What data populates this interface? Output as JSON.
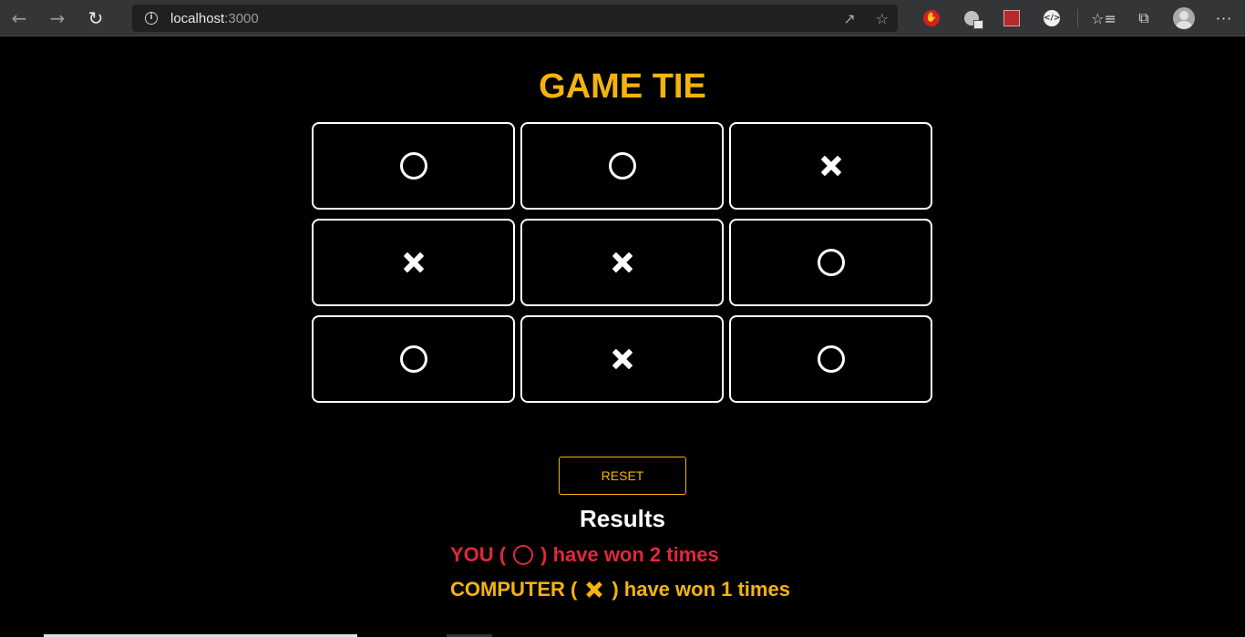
{
  "browser": {
    "url_host": "localhost",
    "url_port": ":3000"
  },
  "game": {
    "status": "GAME TIE",
    "board": [
      "O",
      "O",
      "X",
      "X",
      "X",
      "O",
      "O",
      "X",
      "O"
    ],
    "reset_label": "RESET"
  },
  "results": {
    "heading": "Results",
    "you": {
      "prefix": "YOU (",
      "suffix": ") have won 2 times",
      "wins": 2,
      "mark": "O"
    },
    "computer": {
      "prefix": "COMPUTER (",
      "suffix": ") have won 1 times",
      "wins": 1,
      "mark": "X"
    }
  },
  "colors": {
    "accent": "#f5b40b",
    "you": "#e0283c",
    "background": "#000000"
  }
}
